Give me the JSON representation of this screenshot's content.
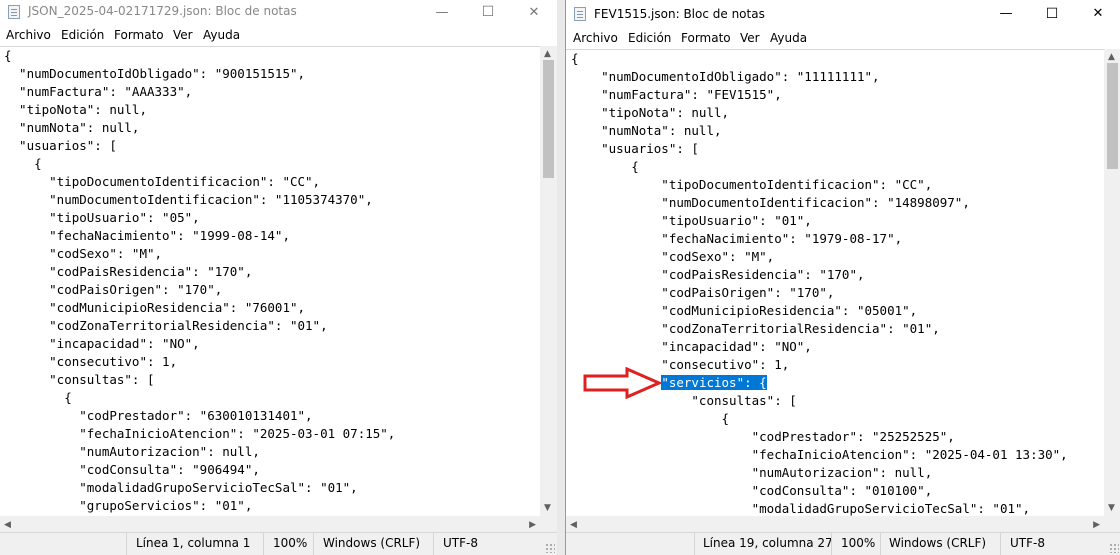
{
  "left_window": {
    "title": "JSON_2025-04-02171729.json: Bloc de notas",
    "menu": [
      "Archivo",
      "Edición",
      "Formato",
      "Ver",
      "Ayuda"
    ],
    "lines": [
      "{",
      "  \"numDocumentoIdObligado\": \"900151515\",",
      "  \"numFactura\": \"AAA333\",",
      "  \"tipoNota\": null,",
      "  \"numNota\": null,",
      "  \"usuarios\": [",
      "    {",
      "      \"tipoDocumentoIdentificacion\": \"CC\",",
      "      \"numDocumentoIdentificacion\": \"1105374370\",",
      "      \"tipoUsuario\": \"05\",",
      "      \"fechaNacimiento\": \"1999-08-14\",",
      "      \"codSexo\": \"M\",",
      "      \"codPaisResidencia\": \"170\",",
      "      \"codPaisOrigen\": \"170\",",
      "      \"codMunicipioResidencia\": \"76001\",",
      "      \"codZonaTerritorialResidencia\": \"01\",",
      "      \"incapacidad\": \"NO\",",
      "      \"consecutivo\": 1,",
      "      \"consultas\": [",
      "        {",
      "          \"codPrestador\": \"630010131401\",",
      "          \"fechaInicioAtencion\": \"2025-03-01 07:15\",",
      "          \"numAutorizacion\": null,",
      "          \"codConsulta\": \"906494\",",
      "          \"modalidadGrupoServicioTecSal\": \"01\",",
      "          \"grupoServicios\": \"01\","
    ],
    "status": {
      "position": "Línea 1, columna 1",
      "zoom": "100%",
      "line_ending": "Windows (CRLF)",
      "encoding": "UTF-8"
    }
  },
  "right_window": {
    "title": "FEV1515.json: Bloc de notas",
    "menu": [
      "Archivo",
      "Edición",
      "Formato",
      "Ver",
      "Ayuda"
    ],
    "lines": [
      "{",
      "    \"numDocumentoIdObligado\": \"11111111\",",
      "    \"numFactura\": \"FEV1515\",",
      "    \"tipoNota\": null,",
      "    \"numNota\": null,",
      "    \"usuarios\": [",
      "        {",
      "            \"tipoDocumentoIdentificacion\": \"CC\",",
      "            \"numDocumentoIdentificacion\": \"14898097\",",
      "            \"tipoUsuario\": \"01\",",
      "            \"fechaNacimiento\": \"1979-08-17\",",
      "            \"codSexo\": \"M\",",
      "            \"codPaisResidencia\": \"170\",",
      "            \"codPaisOrigen\": \"170\",",
      "            \"codMunicipioResidencia\": \"05001\",",
      "            \"codZonaTerritorialResidencia\": \"01\",",
      "            \"incapacidad\": \"NO\",",
      "            \"consecutivo\": 1,",
      "            \"servicios\": {",
      "                \"consultas\": [",
      "                    {",
      "                        \"codPrestador\": \"25252525\",",
      "                        \"fechaInicioAtencion\": \"2025-04-01 13:30\",",
      "                        \"numAutorizacion\": null,",
      "                        \"codConsulta\": \"010100\",",
      "                        \"modalidadGrupoServicioTecSal\": \"01\","
    ],
    "highlighted_line_index": 18,
    "highlighted_prefix": "            ",
    "highlighted_text": "\"servicios\": {",
    "status": {
      "position": "Línea 19, columna 27",
      "zoom": "100%",
      "line_ending": "Windows (CRLF)",
      "encoding": "UTF-8"
    }
  },
  "window_controls": {
    "minimize": "—",
    "maximize": "☐",
    "close": "✕"
  },
  "colors": {
    "selection": "#0078d7",
    "annotation_arrow": "#e02020"
  }
}
